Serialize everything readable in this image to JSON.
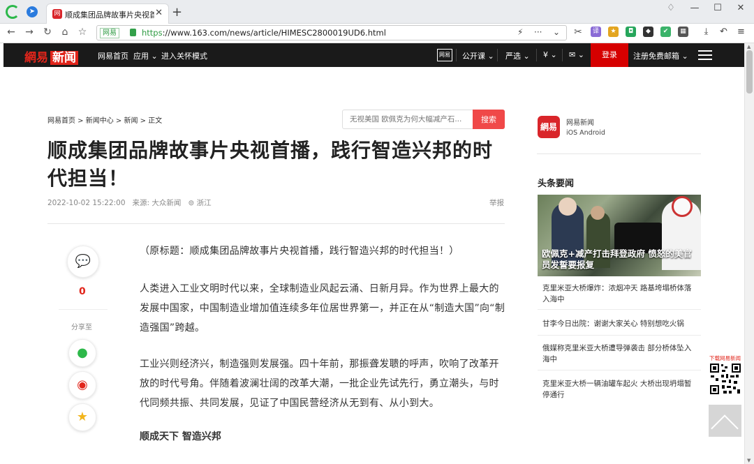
{
  "browser": {
    "tab_title": "顺成集团品牌故事片央视首播",
    "tab_favicon": "网",
    "url_site": "网易",
    "url_https": "https",
    "url_rest": "://www.163.com/news/article/HIMESC2800019UD6.html"
  },
  "topnav": {
    "brand_a": "網易",
    "brand_b": "新闻",
    "links": [
      "网易首页",
      "应用 ⌄",
      "进入关怀模式"
    ],
    "right_links": [
      "公开课 ⌄",
      "严选 ⌄",
      "¥ ⌄",
      "✉ ⌄"
    ],
    "app_label": "网易",
    "login": "登录",
    "register": "注册免费邮箱 ⌄"
  },
  "breadcrumb": "网易首页 > 新闻中心 > 新闻 > 正文",
  "search": {
    "placeholder": "无视美国 欧佩克为何大幅减产石...",
    "button": "搜索"
  },
  "article": {
    "title": "顺成集团品牌故事片央视首播，践行智造兴邦的时代担当！",
    "date": "2022-10-02 15:22:00",
    "source": "来源: 大众新闻",
    "location": "浙江",
    "report": "举报",
    "comment_count": "0",
    "share_label": "分享至",
    "paragraphs": [
      "（原标题：顺成集团品牌故事片央视首播，践行智造兴邦的时代担当！）",
      "人类进入工业文明时代以来，全球制造业风起云涌、日新月异。作为世界上最大的发展中国家，中国制造业增加值连续多年位居世界第一，并正在从“制造大国”向“制造强国”跨越。",
      "工业兴则经济兴，制造强则发展强。四十年前，那振聋发聩的呼声，吹响了改革开放的时代号角。伴随着波澜壮阔的改革大潮，一批企业先试先行，勇立潮头，与时代同频共振、共同发展，见证了中国民营经济从无到有、从小到大。"
    ],
    "subheading": "顺成天下 智造兴邦"
  },
  "sidebar": {
    "app_icon": "網易",
    "app_name": "网易新闻",
    "app_platforms": "iOS   Android",
    "headline_title": "头条要闻",
    "hero_caption": "欧佩克+减产打击拜登政府 愤怒的美官员发誓要报复",
    "news": [
      "克里米亚大桥爆炸：浓烟冲天 路基垮塌桥体落入海中",
      "甘李今日出院：谢谢大家关心 特别想吃火锅",
      "俄媒称克里米亚大桥遭导弹袭击 部分桥体坠入海中",
      "克里米亚大桥一辆油罐车起火 大桥出现坍塌暂停通行"
    ],
    "qr_label_a": "下载",
    "qr_label_b": "网易新闻"
  }
}
